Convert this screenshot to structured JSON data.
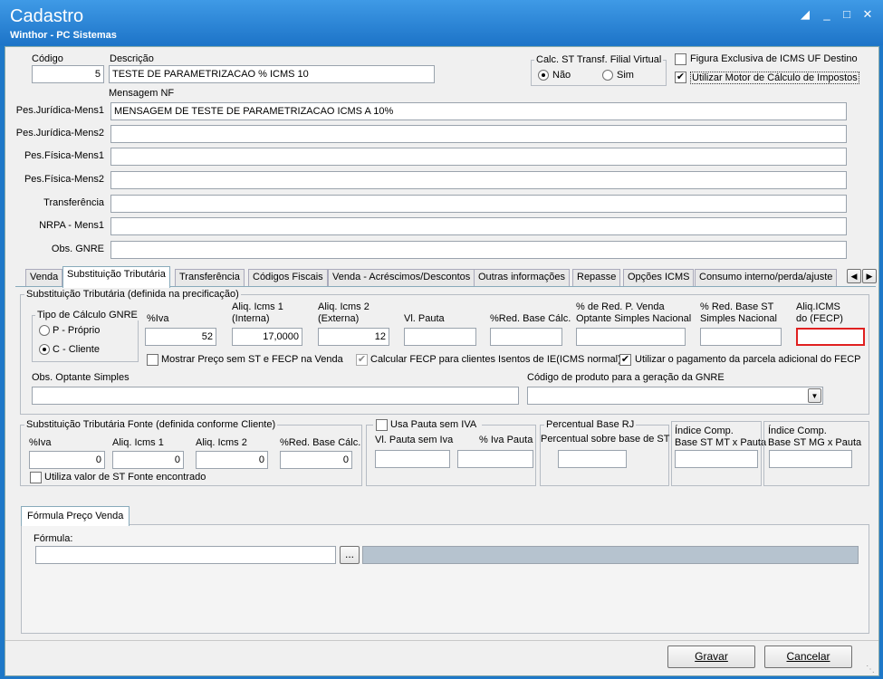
{
  "window": {
    "title": "Cadastro",
    "subtitle": "Winthor - PC Sistemas"
  },
  "header": {
    "codigo_label": "Código",
    "codigo_value": "5",
    "descricao_label": "Descrição",
    "descricao_value": "TESTE DE PARAMETRIZACAO % ICMS 10",
    "calc_st_label": "Calc. ST Transf. Filial Virtual",
    "calc_st_nao": "Não",
    "calc_st_sim": "Sim",
    "figura_label": "Figura Exclusiva de ICMS UF Destino",
    "motor_label": "Utilizar Motor de Cálculo de Impostos",
    "mensagem_nf_label": "Mensagem NF"
  },
  "messages": [
    {
      "label": "Pes.Jurídica-Mens1",
      "value": "MENSAGEM DE TESTE DE PARAMETRIZACAO ICMS A 10%"
    },
    {
      "label": "Pes.Jurídica-Mens2",
      "value": ""
    },
    {
      "label": "Pes.Física-Mens1",
      "value": ""
    },
    {
      "label": "Pes.Física-Mens2",
      "value": ""
    },
    {
      "label": "Transferência",
      "value": ""
    },
    {
      "label": "NRPA - Mens1",
      "value": ""
    },
    {
      "label": "Obs. GNRE",
      "value": ""
    }
  ],
  "tabs": [
    "Venda",
    "Substituição Tributária",
    "Transferência",
    "Códigos Fiscais",
    "Venda - Acréscimos/Descontos",
    "Outras informações",
    "Repasse",
    "Opções ICMS",
    "Consumo interno/perda/ajuste"
  ],
  "st": {
    "group_label": "Substituição Tributária (definida na precificação)",
    "gnre_group": "Tipo de Cálculo GNRE",
    "gnre_proprio": "P - Próprio",
    "gnre_cliente": "C - Cliente",
    "iva_label": "%Iva",
    "iva_value": "52",
    "aliq1_label1": "Aliq. Icms 1",
    "aliq1_label2": "(Interna)",
    "aliq1_value": "17,0000",
    "aliq2_label1": "Aliq. Icms 2",
    "aliq2_label2": "(Externa)",
    "aliq2_value": "12",
    "pauta_label": "Vl. Pauta",
    "pauta_value": "",
    "redbase_label": "%Red. Base Cálc.",
    "redbase_value": "",
    "redvenda_label1": "% de Red. P. Venda",
    "redvenda_label2": "Optante Simples Nacional",
    "redvenda_value": "",
    "redst_label1": "% Red. Base ST",
    "redst_label2": "Simples Nacional",
    "redst_value": "",
    "fecp_label1": "Aliq.ICMS",
    "fecp_label2": "do (FECP)",
    "fecp_value": "",
    "mostrar_label": "Mostrar Preço sem ST e FECP na Venda",
    "calcular_label": "Calcular FECP para clientes Isentos de IE(ICMS normal)",
    "utilizar_label": "Utilizar o pagamento da parcela adicional do FECP",
    "obs_label": "Obs. Optante Simples",
    "obs_value": "",
    "codigo_gnre_label": "Código de produto para a geração da GNRE",
    "codigo_gnre_value": ""
  },
  "fonte": {
    "group_label": "Substituição Tributária Fonte (definida conforme Cliente)",
    "iva_label": "%Iva",
    "iva_value": "0",
    "aliq1_label": "Aliq. Icms 1",
    "aliq1_value": "0",
    "aliq2_label": "Aliq. Icms 2",
    "aliq2_value": "0",
    "red_label": "%Red. Base Cálc.",
    "red_value": "0",
    "utiliza_label": "Utiliza valor de ST Fonte encontrado"
  },
  "pauta": {
    "usa_label": "Usa Pauta sem IVA",
    "vl_label": "Vl. Pauta sem Iva",
    "vl_value": "",
    "iva_label": "% Iva Pauta",
    "iva_value": ""
  },
  "rj": {
    "group_label": "Percentual Base RJ",
    "label": "Percentual sobre base de ST",
    "value": ""
  },
  "mt": {
    "label1": "Índice Comp.",
    "label2": "Base ST MT x Pauta",
    "value": ""
  },
  "mg": {
    "label1": "Índice Comp.",
    "label2": "Base ST MG x Pauta",
    "value": ""
  },
  "formula": {
    "tab_label": "Fórmula Preço Venda",
    "label": "Fórmula:",
    "value": "",
    "browse": "..."
  },
  "buttons": {
    "gravar": "Gravar",
    "cancelar": "Cancelar"
  },
  "colors": {
    "title_bar": "#1d74c8",
    "fecp_border": "#e02020"
  }
}
